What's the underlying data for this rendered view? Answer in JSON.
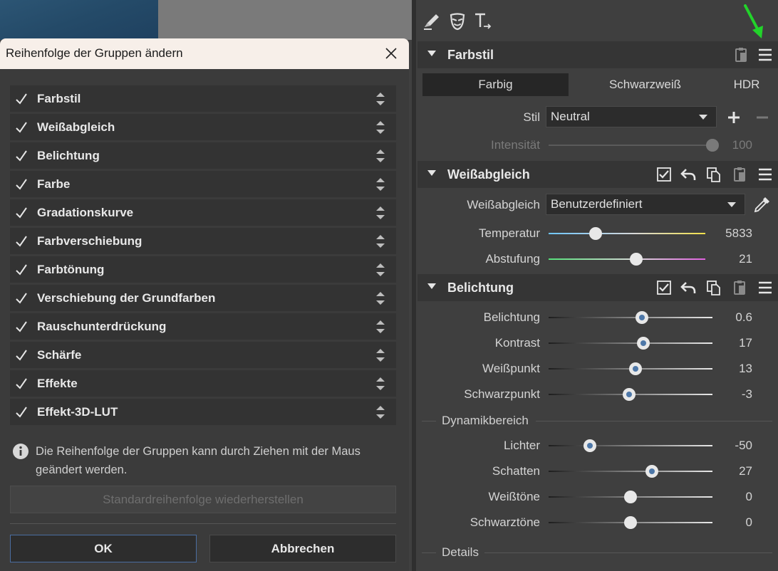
{
  "dialog": {
    "title": "Reihenfolge der Gruppen ändern",
    "close_icon": "close-icon",
    "groups": [
      {
        "label": "Farbstil",
        "checked": true
      },
      {
        "label": "Weißabgleich",
        "checked": true
      },
      {
        "label": "Belichtung",
        "checked": true
      },
      {
        "label": "Farbe",
        "checked": true
      },
      {
        "label": "Gradationskurve",
        "checked": true
      },
      {
        "label": "Farbverschiebung",
        "checked": true
      },
      {
        "label": "Farbtönung",
        "checked": true
      },
      {
        "label": "Verschiebung der Grundfarben",
        "checked": true
      },
      {
        "label": "Rauschunterdrückung",
        "checked": true
      },
      {
        "label": "Schärfe",
        "checked": true
      },
      {
        "label": "Effekte",
        "checked": true
      },
      {
        "label": "Effekt-3D-LUT",
        "checked": true
      }
    ],
    "info_text": "Die Reihenfolge der Gruppen kann durch Ziehen mit der Maus geändert werden.",
    "reset_label": "Standardreihenfolge wiederherstellen",
    "ok_label": "OK",
    "cancel_label": "Abbrechen"
  },
  "panel": {
    "tools": [
      "brush-icon",
      "mask-icon",
      "text-tool-icon"
    ],
    "farbstil": {
      "title": "Farbstil",
      "tabs": [
        "Farbig",
        "Schwarzweiß",
        "HDR"
      ],
      "active_tab": 0,
      "stil_label": "Stil",
      "stil_value": "Neutral",
      "intensity_label": "Intensität",
      "intensity_value": "100",
      "intensity_fraction": 1.0
    },
    "weissabgleich": {
      "title": "Weißabgleich",
      "wb_label": "Weißabgleich",
      "wb_value": "Benutzerdefiniert",
      "sliders": [
        {
          "label": "Temperatur",
          "value": "5833",
          "fraction": 0.3,
          "gradient": "temperature"
        },
        {
          "label": "Abstufung",
          "value": "21",
          "fraction": 0.56,
          "gradient": "tint"
        }
      ]
    },
    "belichtung": {
      "title": "Belichtung",
      "sliders": [
        {
          "label": "Belichtung",
          "value": "0.6",
          "fraction": 0.57,
          "dot": true
        },
        {
          "label": "Kontrast",
          "value": "17",
          "fraction": 0.58,
          "dot": true
        },
        {
          "label": "Weißpunkt",
          "value": "13",
          "fraction": 0.53,
          "dot": true
        },
        {
          "label": "Schwarzpunkt",
          "value": "-3",
          "fraction": 0.49,
          "dot": true
        }
      ],
      "dynamic_title": "Dynamikbereich",
      "dynamic_sliders": [
        {
          "label": "Lichter",
          "value": "-50",
          "fraction": 0.25,
          "dot": true
        },
        {
          "label": "Schatten",
          "value": "27",
          "fraction": 0.63,
          "dot": true
        },
        {
          "label": "Weißtöne",
          "value": "0",
          "fraction": 0.5,
          "dot": false
        },
        {
          "label": "Schwarztöne",
          "value": "0",
          "fraction": 0.5,
          "dot": false
        }
      ],
      "details_title": "Details"
    },
    "accent_colors": {
      "ok_border": "#4a6da0",
      "knob_dot": "#4d77a8",
      "green_arrow": "#22d32a"
    }
  }
}
